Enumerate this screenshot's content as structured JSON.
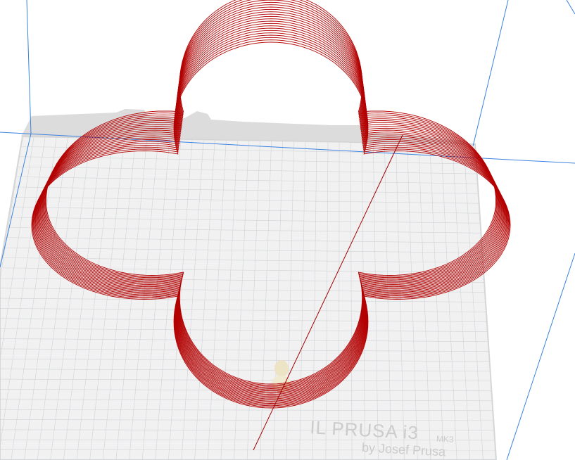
{
  "viewport": {
    "bed_logo": {
      "main": "IL PRUSA i3",
      "model": "MK3",
      "byline": "by Josef Prusa"
    }
  },
  "colors": {
    "background": "#ffffff",
    "bed_surface": "#f0f0f0",
    "bed_grid": "#cfcfcf",
    "bed_edge": "#d8d8d8",
    "build_volume_lines": "#3b82e0",
    "toolpath": "#b30000",
    "nozzle_marker": "#f0ead0"
  },
  "icons": {
    "nozzle_marker": "nozzle-marker-icon"
  }
}
